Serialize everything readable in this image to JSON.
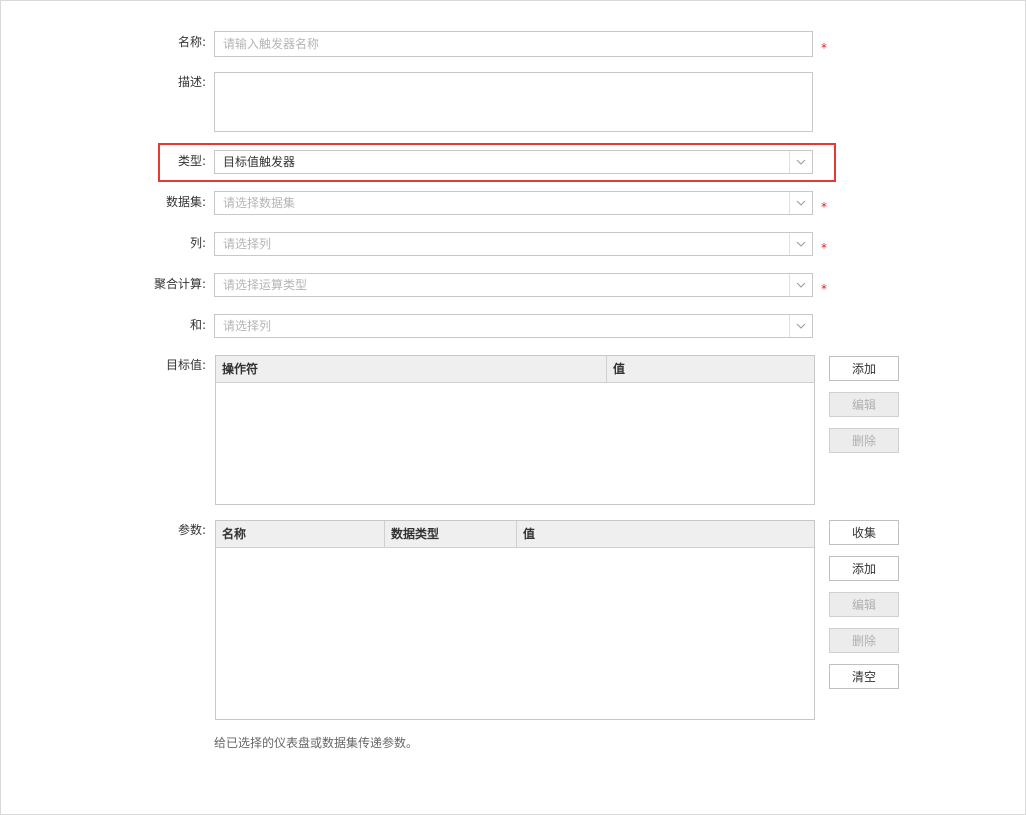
{
  "form": {
    "name": {
      "label": "名称:",
      "placeholder": "请输入触发器名称",
      "required": "*"
    },
    "description": {
      "label": "描述:",
      "value": ""
    },
    "type": {
      "label": "类型:",
      "value": "目标值触发器"
    },
    "dataset": {
      "label": "数据集:",
      "placeholder": "请选择数据集",
      "required": "*"
    },
    "column": {
      "label": "列:",
      "placeholder": "请选择列",
      "required": "*"
    },
    "aggregation": {
      "label": "聚合计算:",
      "placeholder": "请选择运算类型",
      "required": "*"
    },
    "and": {
      "label": "和:",
      "placeholder": "请选择列"
    }
  },
  "target": {
    "label": "目标值:",
    "columns": [
      "操作符",
      "值"
    ],
    "rows": [],
    "buttons": {
      "add": "添加",
      "edit": "编辑",
      "delete": "删除"
    }
  },
  "params": {
    "label": "参数:",
    "columns": [
      "名称",
      "数据类型",
      "值"
    ],
    "rows": [],
    "buttons": {
      "collect": "收集",
      "add": "添加",
      "edit": "编辑",
      "delete": "删除",
      "clear": "清空"
    },
    "hint": "给已选择的仪表盘或数据集传递参数。"
  },
  "colors": {
    "highlight": "#e53935",
    "required": "#e02424"
  },
  "icons": {
    "select_arrow": "chevron-down-icon"
  }
}
